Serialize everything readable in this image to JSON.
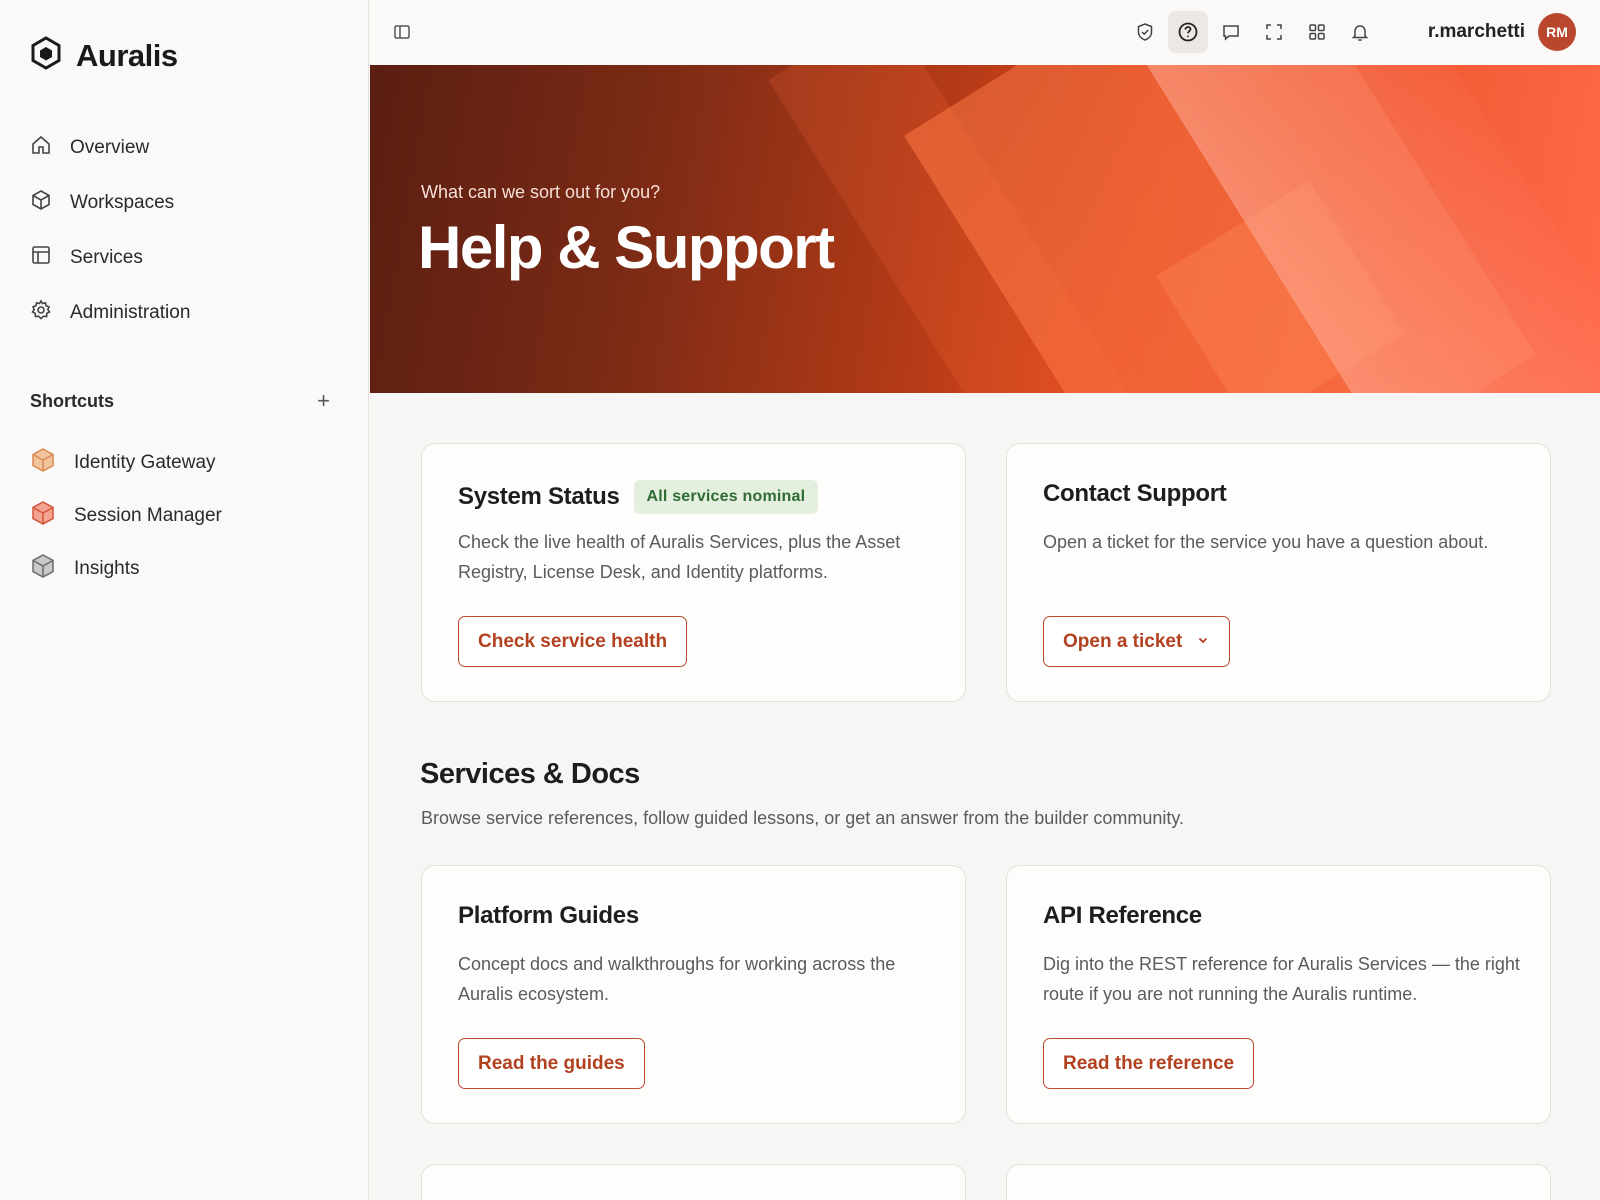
{
  "brand": {
    "name": "Auralis"
  },
  "nav": [
    {
      "label": "Overview",
      "icon": "home-icon"
    },
    {
      "label": "Workspaces",
      "icon": "cube-icon"
    },
    {
      "label": "Services",
      "icon": "layout-icon"
    },
    {
      "label": "Administration",
      "icon": "gear-icon"
    }
  ],
  "shortcuts": {
    "title": "Shortcuts",
    "add_label": "+",
    "items": [
      {
        "label": "Identity Gateway",
        "color": "#d98b54"
      },
      {
        "label": "Session Manager",
        "color": "#d4543a"
      },
      {
        "label": "Insights",
        "color": "#6b6b6b"
      }
    ]
  },
  "topbar": {
    "username": "r.marchetti",
    "avatar_initials": "RM",
    "icons": [
      "shield-check-icon",
      "help-icon",
      "message-icon",
      "fullscreen-icon",
      "apps-grid-icon",
      "bell-icon"
    ],
    "active_icon": "help-icon"
  },
  "hero": {
    "subtitle": "What can we sort out for you?",
    "title": "Help & Support"
  },
  "system_status": {
    "title": "System Status",
    "badge": "All services nominal",
    "description": "Check the live health of Auralis Services, plus the Asset Registry, License Desk, and Identity platforms.",
    "button": "Check service health"
  },
  "contact_support": {
    "title": "Contact Support",
    "description": "Open a ticket for the service you have a question about.",
    "button": "Open a ticket"
  },
  "docs_section": {
    "title": "Services & Docs",
    "description": "Browse service references, follow guided lessons, or get an answer from the builder community."
  },
  "platform_guides": {
    "title": "Platform Guides",
    "description": "Concept docs and walkthroughs for working across the Auralis ecosystem.",
    "button": "Read the guides"
  },
  "api_reference": {
    "title": "API Reference",
    "description": "Dig into the REST reference for Auralis Services — the right route if you are not running the Auralis runtime.",
    "button": "Read the reference"
  },
  "colors": {
    "accent": "#b2411f",
    "badge_bg": "#e4efe0",
    "badge_text": "#2f6b33"
  }
}
